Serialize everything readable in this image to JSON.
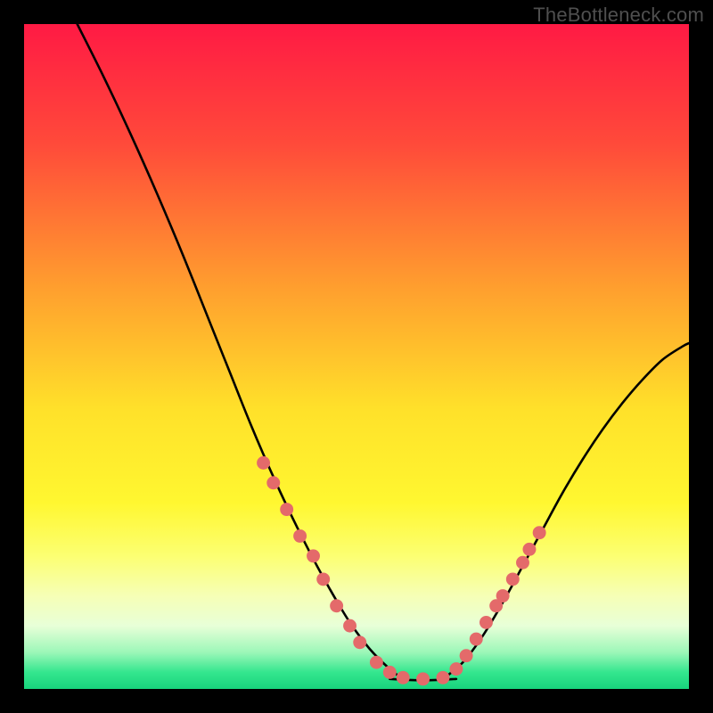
{
  "watermark": "TheBottleneck.com",
  "chart_data": {
    "type": "line",
    "title": "",
    "xlabel": "",
    "ylabel": "",
    "xlim": [
      0,
      100
    ],
    "ylim": [
      0,
      100
    ],
    "gradient_stops": [
      {
        "offset": 0.0,
        "color": "#ff1a44"
      },
      {
        "offset": 0.18,
        "color": "#ff4a3a"
      },
      {
        "offset": 0.4,
        "color": "#ffa02e"
      },
      {
        "offset": 0.58,
        "color": "#ffe12a"
      },
      {
        "offset": 0.72,
        "color": "#fff730"
      },
      {
        "offset": 0.8,
        "color": "#fcff72"
      },
      {
        "offset": 0.86,
        "color": "#f6ffb6"
      },
      {
        "offset": 0.905,
        "color": "#e8ffd8"
      },
      {
        "offset": 0.945,
        "color": "#9cf7b8"
      },
      {
        "offset": 0.975,
        "color": "#34e68e"
      },
      {
        "offset": 1.0,
        "color": "#18d47d"
      }
    ],
    "series": [
      {
        "name": "left-curve",
        "description": "Steep descending curve from top-left down to the valley floor",
        "x": [
          8,
          12,
          16,
          20,
          24,
          28,
          31,
          34,
          37,
          40,
          43,
          46,
          49,
          52,
          55,
          57
        ],
        "y": [
          100,
          92,
          83.5,
          74.5,
          65,
          55,
          47.5,
          40,
          33,
          26.5,
          20.5,
          15,
          10,
          6,
          3,
          1.5
        ]
      },
      {
        "name": "valley-floor",
        "description": "Flat segment at the bottom of the V",
        "x": [
          55,
          60,
          65
        ],
        "y": [
          1.5,
          1.3,
          1.5
        ]
      },
      {
        "name": "right-curve",
        "description": "Ascending curve from valley floor up to the right edge, flattening",
        "x": [
          63,
          66,
          69,
          72,
          75,
          78,
          81,
          84,
          87,
          90,
          93,
          96,
          99,
          100
        ],
        "y": [
          1.5,
          4,
          8,
          13,
          18.5,
          24,
          29.5,
          34.5,
          39,
          43,
          46.5,
          49.5,
          51.5,
          52
        ]
      }
    ],
    "markers": {
      "name": "highlight-dots",
      "color": "#e46a6a",
      "radius_units": 1.0,
      "points": [
        {
          "x": 36.0,
          "y": 34.0
        },
        {
          "x": 37.5,
          "y": 31.0
        },
        {
          "x": 39.5,
          "y": 27.0
        },
        {
          "x": 41.5,
          "y": 23.0
        },
        {
          "x": 43.5,
          "y": 20.0
        },
        {
          "x": 45.0,
          "y": 16.5
        },
        {
          "x": 47.0,
          "y": 12.5
        },
        {
          "x": 49.0,
          "y": 9.5
        },
        {
          "x": 50.5,
          "y": 7.0
        },
        {
          "x": 53.0,
          "y": 4.0
        },
        {
          "x": 55.0,
          "y": 2.5
        },
        {
          "x": 57.0,
          "y": 1.7
        },
        {
          "x": 60.0,
          "y": 1.5
        },
        {
          "x": 63.0,
          "y": 1.7
        },
        {
          "x": 65.0,
          "y": 3.0
        },
        {
          "x": 66.5,
          "y": 5.0
        },
        {
          "x": 68.0,
          "y": 7.5
        },
        {
          "x": 69.5,
          "y": 10.0
        },
        {
          "x": 71.0,
          "y": 12.5
        },
        {
          "x": 72.0,
          "y": 14.0
        },
        {
          "x": 73.5,
          "y": 16.5
        },
        {
          "x": 75.0,
          "y": 19.0
        },
        {
          "x": 76.0,
          "y": 21.0
        },
        {
          "x": 77.5,
          "y": 23.5
        }
      ]
    }
  }
}
